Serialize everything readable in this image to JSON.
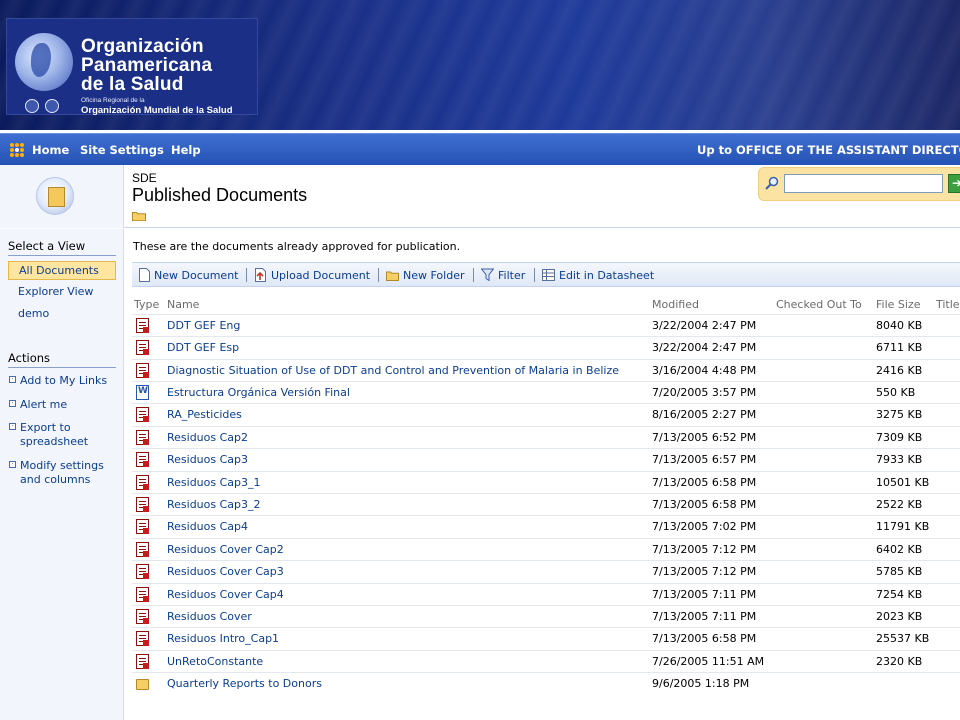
{
  "banner": {
    "org_line1": "Organización",
    "org_line2": "Panamericana",
    "org_line3": "de la Salud",
    "office_small": "Oficina Regional de la",
    "oms_line": "Organización Mundial de la Salud"
  },
  "topnav": {
    "home": "Home",
    "site_settings": "Site Settings",
    "help": "Help",
    "up_to": "Up to OFFICE OF THE ASSISTANT DIRECTO"
  },
  "header": {
    "site_name": "SDE",
    "page_title": "Published Documents"
  },
  "search": {
    "value": "",
    "go_label": "➔"
  },
  "leftnav": {
    "select_view_heading": "Select a View",
    "views": [
      "All Documents",
      "Explorer View",
      "demo"
    ],
    "actions_heading": "Actions",
    "actions": [
      "Add to My Links",
      "Alert me",
      "Export to spreadsheet",
      "Modify settings and columns"
    ]
  },
  "description": "These are the documents already approved for publication.",
  "toolbar": {
    "new_document": "New Document",
    "upload_document": "Upload Document",
    "new_folder": "New Folder",
    "filter": "Filter",
    "edit_datasheet": "Edit in Datasheet",
    "separator": "|"
  },
  "columns": [
    "Type",
    "Name",
    "Modified",
    "Checked Out To",
    "File Size",
    "Title"
  ],
  "rows": [
    {
      "type": "pdf",
      "name": "DDT GEF Eng",
      "modified": "3/22/2004 2:47 PM",
      "size": "8040 KB"
    },
    {
      "type": "pdf",
      "name": "DDT GEF Esp",
      "modified": "3/22/2004 2:47 PM",
      "size": "6711 KB"
    },
    {
      "type": "pdf",
      "name": "Diagnostic Situation of Use of DDT and Control and Prevention of Malaria in Belize",
      "modified": "3/16/2004 4:48 PM",
      "size": "2416 KB"
    },
    {
      "type": "doc",
      "name": "Estructura Orgánica Versión Final",
      "modified": "7/20/2005 3:57 PM",
      "size": "550 KB"
    },
    {
      "type": "pdf",
      "name": "RA_Pesticides",
      "modified": "8/16/2005 2:27 PM",
      "size": "3275 KB"
    },
    {
      "type": "pdf",
      "name": "Residuos Cap2",
      "modified": "7/13/2005 6:52 PM",
      "size": "7309 KB"
    },
    {
      "type": "pdf",
      "name": "Residuos Cap3",
      "modified": "7/13/2005 6:57 PM",
      "size": "7933 KB"
    },
    {
      "type": "pdf",
      "name": "Residuos Cap3_1",
      "modified": "7/13/2005 6:58 PM",
      "size": "10501 KB"
    },
    {
      "type": "pdf",
      "name": "Residuos Cap3_2",
      "modified": "7/13/2005 6:58 PM",
      "size": "2522 KB"
    },
    {
      "type": "pdf",
      "name": "Residuos Cap4",
      "modified": "7/13/2005 7:02 PM",
      "size": "11791 KB"
    },
    {
      "type": "pdf",
      "name": "Residuos Cover Cap2",
      "modified": "7/13/2005 7:12 PM",
      "size": "6402 KB"
    },
    {
      "type": "pdf",
      "name": "Residuos Cover Cap3",
      "modified": "7/13/2005 7:12 PM",
      "size": "5785 KB"
    },
    {
      "type": "pdf",
      "name": "Residuos Cover Cap4",
      "modified": "7/13/2005 7:11 PM",
      "size": "7254 KB"
    },
    {
      "type": "pdf",
      "name": "Residuos Cover",
      "modified": "7/13/2005 7:11 PM",
      "size": "2023 KB"
    },
    {
      "type": "pdf",
      "name": "Residuos Intro_Cap1",
      "modified": "7/13/2005 6:58 PM",
      "size": "25537 KB"
    },
    {
      "type": "pdf",
      "name": "UnRetoConstante",
      "modified": "7/26/2005 11:51 AM",
      "size": "2320 KB"
    },
    {
      "type": "folder",
      "name": "Quarterly Reports to Donors",
      "modified": "9/6/2005 1:18 PM",
      "size": ""
    }
  ],
  "colors": {
    "banner_dark": "#0a1a5c",
    "nav_blue": "#2553b5",
    "link_blue": "#0b3d91",
    "selected_view": "#ffe6a0",
    "search_panel": "#fbe3a4"
  }
}
